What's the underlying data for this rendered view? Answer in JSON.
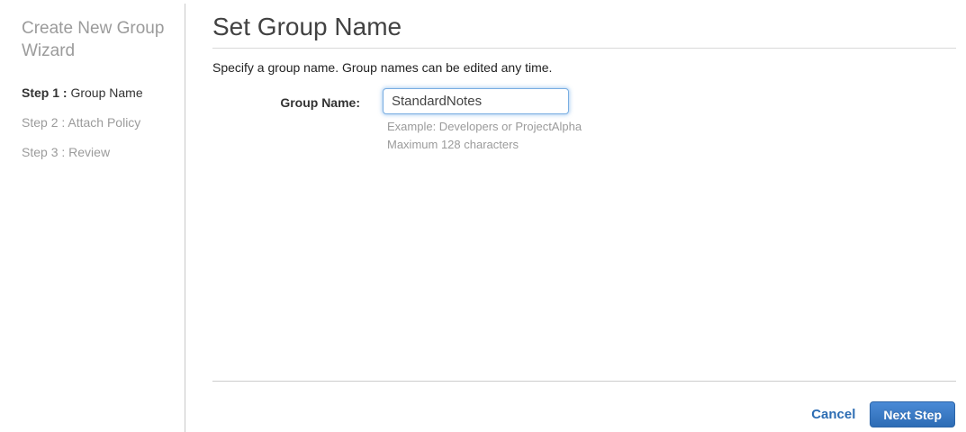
{
  "sidebar": {
    "title": "Create New Group Wizard",
    "steps": [
      {
        "prefix": "Step 1 :",
        "label": " Group Name",
        "active": true
      },
      {
        "prefix": "Step 2 :",
        "label": " Attach Policy",
        "active": false
      },
      {
        "prefix": "Step 3 :",
        "label": " Review",
        "active": false
      }
    ]
  },
  "main": {
    "title": "Set Group Name",
    "description": "Specify a group name. Group names can be edited any time.",
    "form": {
      "label": "Group Name:",
      "value": "StandardNotes",
      "hint_line1": "Example: Developers or ProjectAlpha",
      "hint_line2": "Maximum 128 characters"
    },
    "footer": {
      "cancel_label": "Cancel",
      "next_label": "Next Step"
    }
  },
  "colors": {
    "accent_blue": "#2d6db3",
    "button_gradient_top": "#4a8ad6",
    "button_gradient_bottom": "#2d6cb5",
    "inactive_text": "#9b9b9b",
    "divider": "#c9c9c9"
  }
}
